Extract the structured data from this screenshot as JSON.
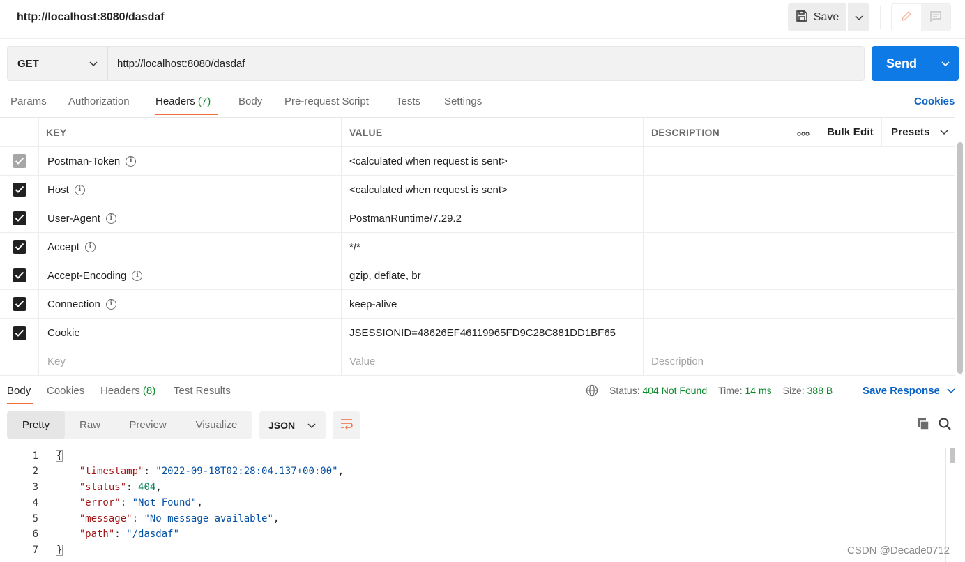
{
  "request": {
    "title": "http://localhost:8080/dasdaf",
    "method": "GET",
    "url": "http://localhost:8080/dasdaf",
    "save_label": "Save",
    "send_label": "Send"
  },
  "request_tabs": [
    {
      "label": "Params"
    },
    {
      "label": "Authorization"
    },
    {
      "label": "Headers",
      "count": "(7)",
      "active": true
    },
    {
      "label": "Body"
    },
    {
      "label": "Pre-request Script"
    },
    {
      "label": "Tests"
    },
    {
      "label": "Settings"
    }
  ],
  "cookies_label": "Cookies",
  "headers_table": {
    "columns": {
      "key": "KEY",
      "value": "VALUE",
      "description": "DESCRIPTION"
    },
    "more_label": "ooo",
    "bulk_edit_label": "Bulk Edit",
    "presets_label": "Presets",
    "rows": [
      {
        "key": "Postman-Token",
        "value": "<calculated when request is sent>",
        "checked": true,
        "disabled": true
      },
      {
        "key": "Host",
        "value": "<calculated when request is sent>",
        "checked": true
      },
      {
        "key": "User-Agent",
        "value": "PostmanRuntime/7.29.2",
        "checked": true
      },
      {
        "key": "Accept",
        "value": "*/*",
        "checked": true
      },
      {
        "key": "Accept-Encoding",
        "value": "gzip, deflate, br",
        "checked": true
      },
      {
        "key": "Connection",
        "value": "keep-alive",
        "checked": true
      },
      {
        "key": "Cookie",
        "value": "JSESSIONID=48626EF46119965FD9C28C881DD1BF65",
        "checked": true
      }
    ],
    "placeholders": {
      "key": "Key",
      "value": "Value",
      "description": "Description"
    }
  },
  "response": {
    "tabs": [
      {
        "label": "Body",
        "active": true
      },
      {
        "label": "Cookies"
      },
      {
        "label": "Headers",
        "count": "(8)"
      },
      {
        "label": "Test Results"
      }
    ],
    "status_label": "Status:",
    "status_value": "404 Not Found",
    "time_label": "Time:",
    "time_value": "14 ms",
    "size_label": "Size:",
    "size_value": "388 B",
    "save_response_label": "Save Response",
    "views": [
      "Pretty",
      "Raw",
      "Preview",
      "Visualize"
    ],
    "active_view": "Pretty",
    "format": "JSON",
    "body_lines": [
      {
        "num": "1",
        "open": "{"
      },
      {
        "num": "2",
        "key": "\"timestamp\"",
        "val": "\"2022-09-18T02:28:04.137+00:00\"",
        "type": "string",
        "comma": ","
      },
      {
        "num": "3",
        "key": "\"status\"",
        "val": "404",
        "type": "number",
        "comma": ","
      },
      {
        "num": "4",
        "key": "\"error\"",
        "val": "\"Not Found\"",
        "type": "string",
        "comma": ","
      },
      {
        "num": "5",
        "key": "\"message\"",
        "val": "\"No message available\"",
        "type": "string",
        "comma": ","
      },
      {
        "num": "6",
        "key": "\"path\"",
        "val_pre": "\"",
        "val_link": "/dasdaf",
        "val_post": "\"",
        "type": "link",
        "comma": ""
      },
      {
        "num": "7",
        "close": "}"
      }
    ]
  },
  "watermark": "CSDN @Decade0712",
  "colors": {
    "accent": "#f26b3a",
    "send": "#0d7ae6",
    "link": "#0b63c5",
    "success": "#0c8a2c"
  }
}
